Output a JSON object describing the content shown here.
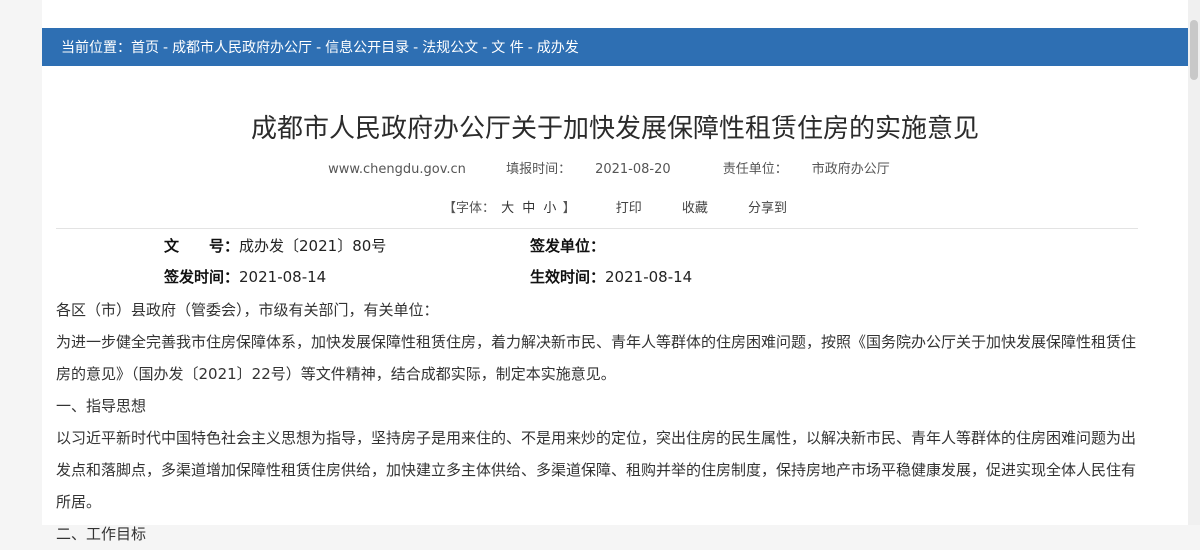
{
  "breadcrumb": {
    "prefix": "当前位置：",
    "items": [
      "首页",
      "成都市人民政府办公厅",
      "信息公开目录",
      "法规公文",
      "文 件",
      "成办发"
    ],
    "separator": "-"
  },
  "title": "成都市人民政府办公厅关于加快发展保障性租赁住房的实施意见",
  "meta": {
    "site": "www.chengdu.gov.cn",
    "date_label": "填报时间：",
    "date": "2021-08-20",
    "unit_label": "责任单位：",
    "unit": "市政府办公厅"
  },
  "tools": {
    "font_open": "【字体：",
    "font_large": "大",
    "font_medium": "中",
    "font_small": "小",
    "font_close": "】",
    "print": "打印",
    "favorite": "收藏",
    "share": "分享到"
  },
  "doc_info": {
    "doc_no_label": "文　　号：",
    "doc_no": "成办发〔2021〕80号",
    "issuer_label": "签发单位：",
    "issuer": "",
    "issue_date_label": "签发时间：",
    "issue_date": "2021-08-14",
    "effective_date_label": "生效时间：",
    "effective_date": "2021-08-14"
  },
  "body": [
    "各区（市）县政府（管委会），市级有关部门，有关单位：",
    "为进一步健全完善我市住房保障体系，加快发展保障性租赁住房，着力解决新市民、青年人等群体的住房困难问题，按照《国务院办公厅关于加快发展保障性租赁住房的意见》（国办发〔2021〕22号）等文件精神，结合成都实际，制定本实施意见。",
    "一、指导思想",
    "以习近平新时代中国特色社会主义思想为指导，坚持房子是用来住的、不是用来炒的定位，突出住房的民生属性，以解决新市民、青年人等群体的住房困难问题为出发点和落脚点，多渠道增加保障性租赁住房供给，加快建立多主体供给、多渠道保障、租购并举的住房制度，保持房地产市场平稳健康发展，促进实现全体人民住有所居。",
    "二、工作目标"
  ]
}
